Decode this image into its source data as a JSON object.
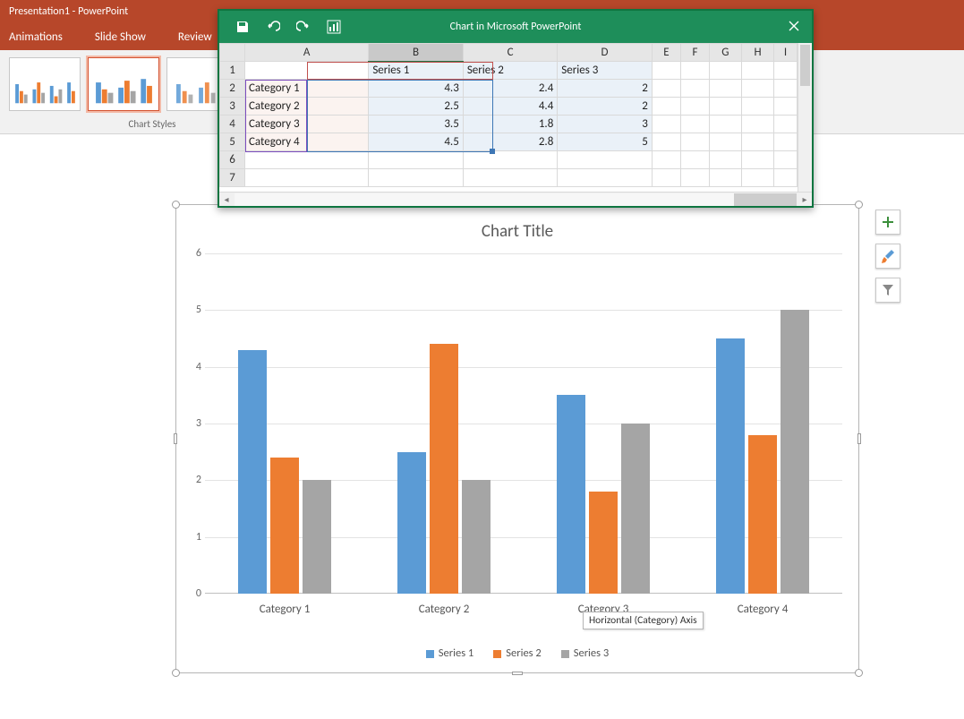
{
  "powerpoint": {
    "window_title": "Presentation1 - PowerPoint",
    "ribbon_tabs": [
      "Animations",
      "Slide Show",
      "Review"
    ],
    "chart_styles_label": "Chart Styles"
  },
  "excel": {
    "window_title": "Chart in Microsoft PowerPoint",
    "columns": [
      "A",
      "B",
      "C",
      "D",
      "E",
      "F",
      "G",
      "H",
      "I"
    ],
    "rows": [
      "1",
      "2",
      "3",
      "4",
      "5",
      "6",
      "7"
    ],
    "selected_col": "B",
    "headers": {
      "b": "Series 1",
      "c": "Series 2",
      "d": "Series 3"
    },
    "data": [
      {
        "a": "Category 1",
        "b": "4.3",
        "c": "2.4",
        "d": "2"
      },
      {
        "a": "Category 2",
        "b": "2.5",
        "c": "4.4",
        "d": "2"
      },
      {
        "a": "Category 3",
        "b": "3.5",
        "c": "1.8",
        "d": "3"
      },
      {
        "a": "Category 4",
        "b": "4.5",
        "c": "2.8",
        "d": "5"
      }
    ]
  },
  "chart": {
    "title": "Chart Title",
    "yticks": [
      "0",
      "1",
      "2",
      "3",
      "4",
      "5",
      "6"
    ],
    "legend": [
      "Series 1",
      "Series 2",
      "Series 3"
    ],
    "categories": [
      "Category 1",
      "Category 2",
      "Category 3",
      "Category 4"
    ],
    "axis_tooltip": "Horizontal (Category) Axis",
    "colors": {
      "s1": "#5B9BD5",
      "s2": "#ED7D31",
      "s3": "#A5A5A5"
    }
  },
  "chart_data": {
    "type": "bar",
    "title": "Chart Title",
    "categories": [
      "Category 1",
      "Category 2",
      "Category 3",
      "Category 4"
    ],
    "series": [
      {
        "name": "Series 1",
        "values": [
          4.3,
          2.5,
          3.5,
          4.5
        ]
      },
      {
        "name": "Series 2",
        "values": [
          2.4,
          4.4,
          1.8,
          2.8
        ]
      },
      {
        "name": "Series 3",
        "values": [
          2,
          2,
          3,
          5
        ]
      }
    ],
    "xlabel": "",
    "ylabel": "",
    "ylim": [
      0,
      6
    ],
    "legend_position": "bottom",
    "grid": true
  }
}
